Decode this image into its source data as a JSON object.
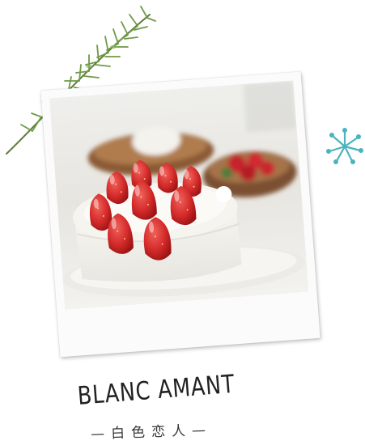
{
  "caption": {
    "title": "BLANC AMANT",
    "subtitle": "—白色恋人—"
  },
  "decorations": {
    "sprig": "rosemary-sprig",
    "ornament": "snowflake-icon",
    "ornament_color": "#4bb3bd"
  },
  "photo": {
    "subject": "strawberry-cream-cake",
    "colors": {
      "strawberry": "#d42a2a",
      "cream": "#f6f4ef",
      "wood": "#8a5a36"
    }
  }
}
